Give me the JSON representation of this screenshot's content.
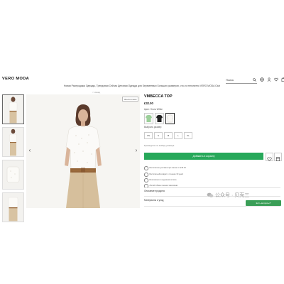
{
  "header": {
    "logo": "VERO MODA",
    "search_label": "Поиск",
    "nav_text": "Новая Распродажа Одежды, Трендовая Сейчас Деловая Одежда для Беременных Больших размеров, что-то непонятно VERO MODA Club"
  },
  "breadcrumb": "< Назад",
  "gallery": {
    "badge": "Экологичная",
    "thumb_count": 4
  },
  "product": {
    "title": "VMBECCA TOP",
    "price": "£32.00",
    "color_label": "Цвет: Snow White",
    "size_label": "Выбрать размер",
    "sizes": [
      "XS",
      "S",
      "M",
      "L",
      "XL"
    ],
    "size_guide": "Руководство по выбору размера",
    "add_to_cart": "Добавить в корзину"
  },
  "info_lines": [
    "Бесплатная доставка при заказе от £35.00",
    "Бесплатный возврат в течение 30 дней",
    "Безопасная и надежная оплата",
    "Легкий обмен в наших магазинах"
  ],
  "accordion": {
    "description": "Описание продукта",
    "materials": "Материалы и уход"
  },
  "watermark": "公众号 · 贝壳三",
  "chat_button": "Есть вопросы?"
}
